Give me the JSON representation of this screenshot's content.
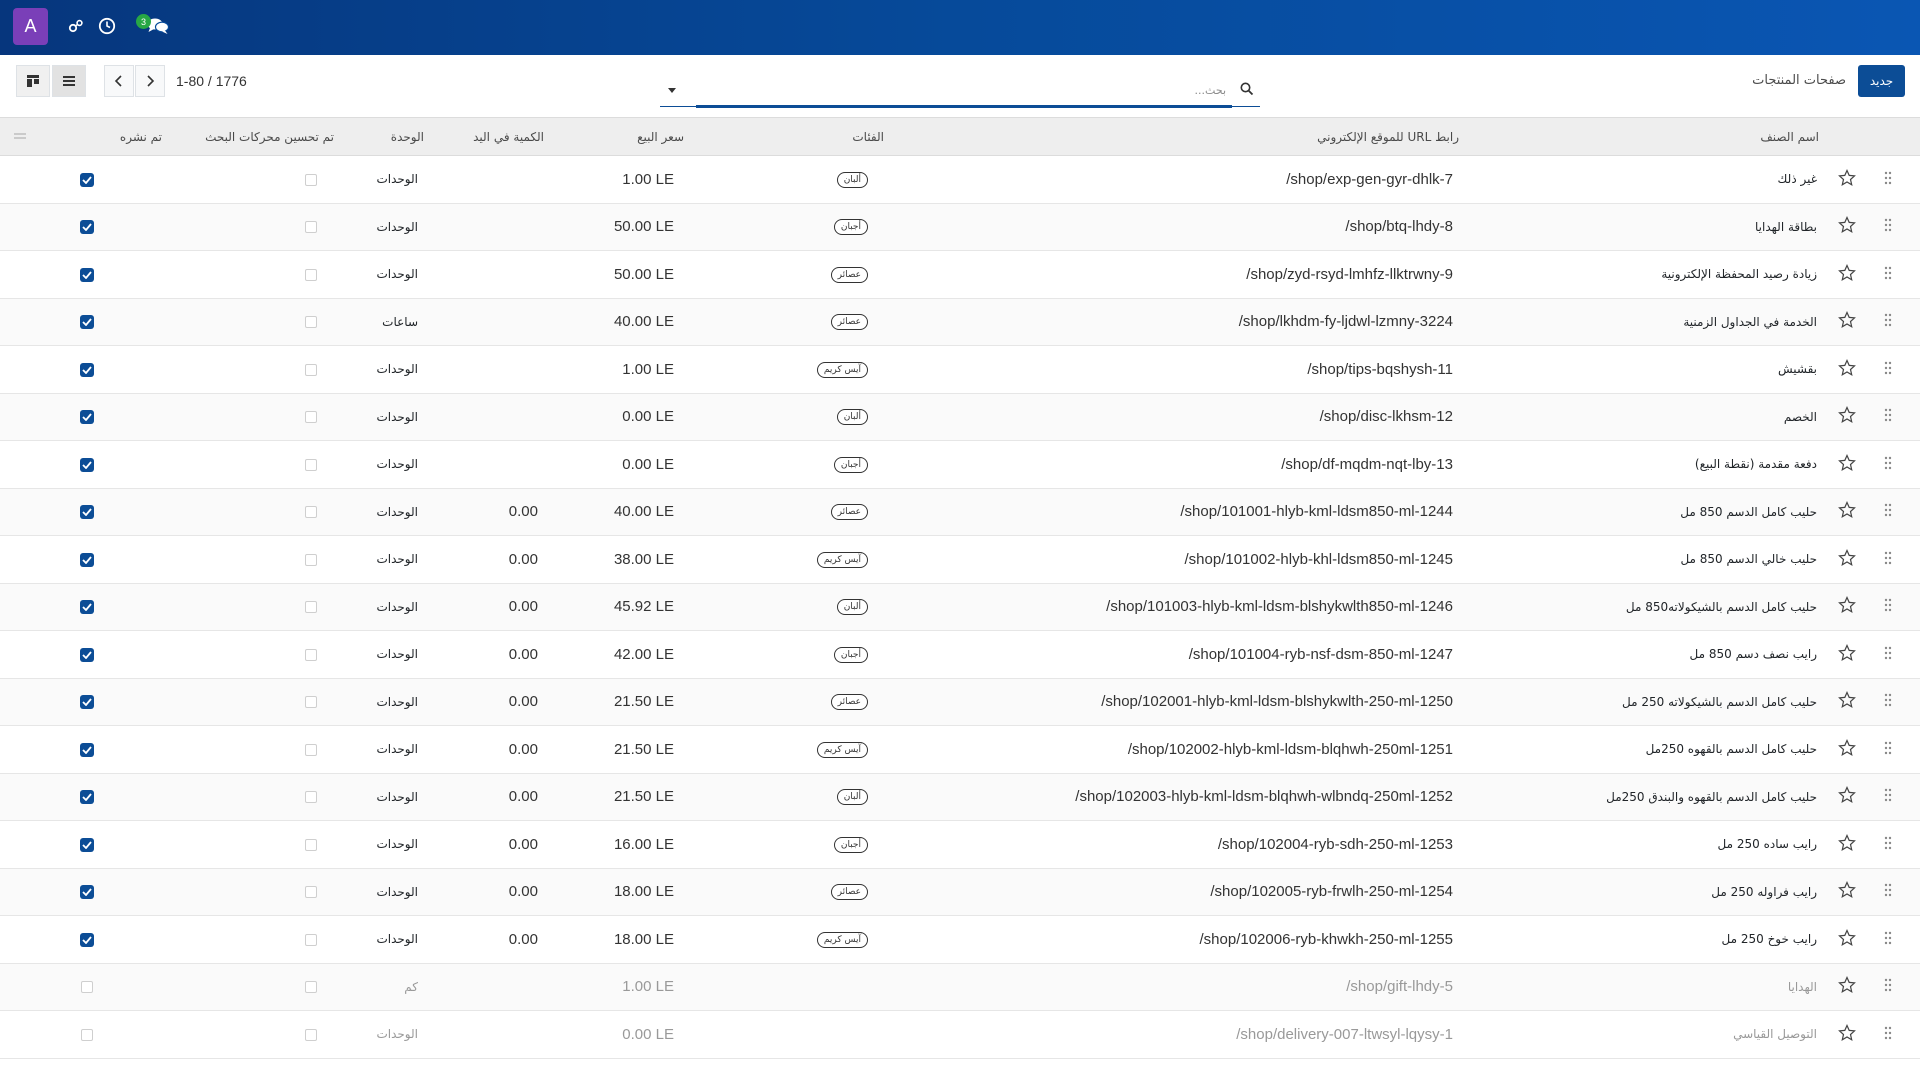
{
  "topbar": {
    "avatar_letter": "A",
    "messages_count": "3"
  },
  "controlbar": {
    "new_button": "جديد",
    "breadcrumb": "صفحات المنتجات",
    "search_placeholder": "بحث...",
    "pager": "1-80 / 1776"
  },
  "columns": {
    "name": "اسم الصنف",
    "url": "رابط URL للموقع الإلكتروني",
    "categories": "الفئات",
    "price": "سعر البيع",
    "qty": "الكمية في اليد",
    "unit": "الوحدة",
    "seo": "تم تحسين محركات البحث",
    "published": "تم نشره"
  },
  "rows": [
    {
      "name": "غير ذلك",
      "url": "/shop/exp-gen-gyr-dhlk-7",
      "category": "ألبان",
      "price": "1.00 LE",
      "qty": "",
      "unit": "الوحدات",
      "published": true,
      "muted": false
    },
    {
      "name": "بطاقة الهدايا",
      "url": "/shop/btq-lhdy-8",
      "category": "أجبان",
      "price": "50.00 LE",
      "qty": "",
      "unit": "الوحدات",
      "published": true,
      "muted": false
    },
    {
      "name": "زيادة رصيد المحفظة الإلكترونية",
      "url": "/shop/zyd-rsyd-lmhfz-llktrwny-9",
      "category": "عصائر",
      "price": "50.00 LE",
      "qty": "",
      "unit": "الوحدات",
      "published": true,
      "muted": false
    },
    {
      "name": "الخدمة في الجداول الزمنية",
      "url": "/shop/lkhdm-fy-ljdwl-lzmny-3224",
      "category": "عصائر",
      "price": "40.00 LE",
      "qty": "",
      "unit": "ساعات",
      "published": true,
      "muted": false
    },
    {
      "name": "بقشيش",
      "url": "/shop/tips-bqshysh-11",
      "category": "آيس كريم",
      "price": "1.00 LE",
      "qty": "",
      "unit": "الوحدات",
      "published": true,
      "muted": false
    },
    {
      "name": "الخصم",
      "url": "/shop/disc-lkhsm-12",
      "category": "ألبان",
      "price": "0.00 LE",
      "qty": "",
      "unit": "الوحدات",
      "published": true,
      "muted": false
    },
    {
      "name": "دفعة مقدمة (نقطة البيع)",
      "url": "/shop/df-mqdm-nqt-lby-13",
      "category": "أجبان",
      "price": "0.00 LE",
      "qty": "",
      "unit": "الوحدات",
      "published": true,
      "muted": false
    },
    {
      "name": "حليب كامل الدسم 850 مل",
      "url": "/shop/101001-hlyb-kml-ldsm850-ml-1244",
      "category": "عصائر",
      "price": "40.00 LE",
      "qty": "0.00",
      "unit": "الوحدات",
      "published": true,
      "muted": false
    },
    {
      "name": "حليب خالي الدسم 850 مل",
      "url": "/shop/101002-hlyb-khl-ldsm850-ml-1245",
      "category": "آيس كريم",
      "price": "38.00 LE",
      "qty": "0.00",
      "unit": "الوحدات",
      "published": true,
      "muted": false
    },
    {
      "name": "حليب كامل الدسم بالشيكولاته850 مل",
      "url": "/shop/101003-hlyb-kml-ldsm-blshykwlth850-ml-1246",
      "category": "ألبان",
      "price": "45.92 LE",
      "qty": "0.00",
      "unit": "الوحدات",
      "published": true,
      "muted": false
    },
    {
      "name": "رايب نصف دسم 850 مل",
      "url": "/shop/101004-ryb-nsf-dsm-850-ml-1247",
      "category": "أجبان",
      "price": "42.00 LE",
      "qty": "0.00",
      "unit": "الوحدات",
      "published": true,
      "muted": false
    },
    {
      "name": "حليب كامل الدسم بالشيكولاته 250 مل",
      "url": "/shop/102001-hlyb-kml-ldsm-blshykwlth-250-ml-1250",
      "category": "عصائر",
      "price": "21.50 LE",
      "qty": "0.00",
      "unit": "الوحدات",
      "published": true,
      "muted": false
    },
    {
      "name": "حليب كامل الدسم بالقهوه 250مل",
      "url": "/shop/102002-hlyb-kml-ldsm-blqhwh-250ml-1251",
      "category": "آيس كريم",
      "price": "21.50 LE",
      "qty": "0.00",
      "unit": "الوحدات",
      "published": true,
      "muted": false
    },
    {
      "name": "حليب كامل الدسم بالقهوه والبندق 250مل",
      "url": "/shop/102003-hlyb-kml-ldsm-blqhwh-wlbndq-250ml-1252",
      "category": "ألبان",
      "price": "21.50 LE",
      "qty": "0.00",
      "unit": "الوحدات",
      "published": true,
      "muted": false
    },
    {
      "name": "رايب ساده 250 مل",
      "url": "/shop/102004-ryb-sdh-250-ml-1253",
      "category": "أجبان",
      "price": "16.00 LE",
      "qty": "0.00",
      "unit": "الوحدات",
      "published": true,
      "muted": false
    },
    {
      "name": "رايب فراوله 250 مل",
      "url": "/shop/102005-ryb-frwlh-250-ml-1254",
      "category": "عصائر",
      "price": "18.00 LE",
      "qty": "0.00",
      "unit": "الوحدات",
      "published": true,
      "muted": false
    },
    {
      "name": "رايب خوخ 250 مل",
      "url": "/shop/102006-ryb-khwkh-250-ml-1255",
      "category": "آيس كريم",
      "price": "18.00 LE",
      "qty": "0.00",
      "unit": "الوحدات",
      "published": true,
      "muted": false
    },
    {
      "name": "الهدايا",
      "url": "/shop/gift-lhdy-5",
      "category": "",
      "price": "1.00 LE",
      "qty": "",
      "unit": "كم",
      "published": false,
      "muted": true
    },
    {
      "name": "التوصيل القياسي",
      "url": "/shop/delivery-007-ltwsyl-lqysy-1",
      "category": "",
      "price": "0.00 LE",
      "qty": "",
      "unit": "الوحدات",
      "published": false,
      "muted": true
    }
  ],
  "colors": {
    "topbar": "#064a9a",
    "accent": "#0c4d96",
    "badge": "#27a745",
    "avatar": "#7a3fb8"
  }
}
